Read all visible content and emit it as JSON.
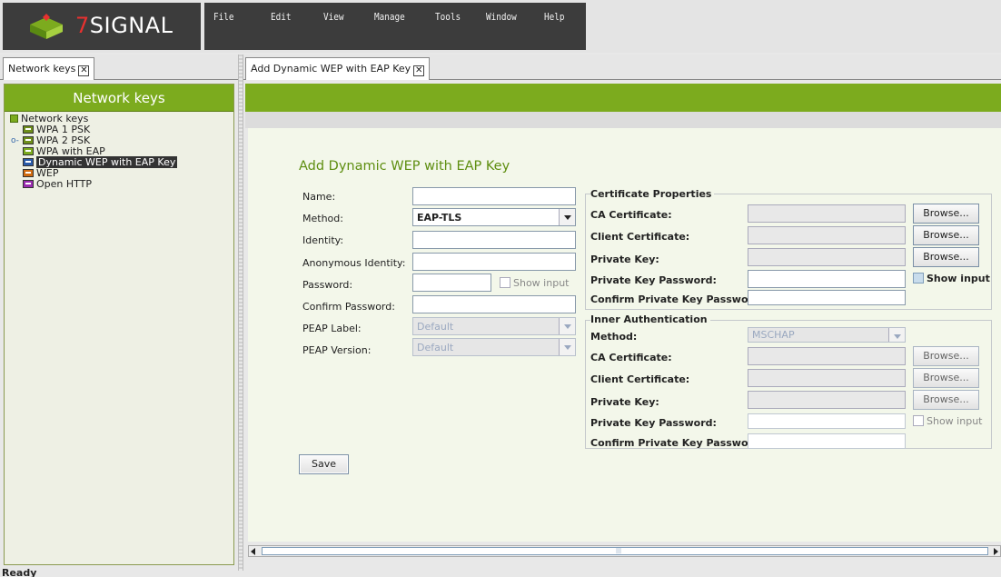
{
  "brand": {
    "name_prefix": "7",
    "name_suffix": "SIGNAL"
  },
  "menu": [
    "File",
    "Edit",
    "View",
    "Manage",
    "Tools",
    "Window",
    "Help"
  ],
  "left": {
    "tab_label": "Network keys",
    "panel_title": "Network keys",
    "tree_root": "Network keys",
    "items": [
      {
        "label": "WPA 1 PSK",
        "color": "#6e8e1a"
      },
      {
        "label": "WPA 2 PSK",
        "color": "#6e8e1a"
      },
      {
        "label": "WPA with EAP",
        "color": "#7cab1e"
      },
      {
        "label": "Dynamic WEP with EAP Key",
        "color": "#2a5aa8"
      },
      {
        "label": "WEP",
        "color": "#d06a10"
      },
      {
        "label": "Open HTTP",
        "color": "#9a2bb0"
      }
    ]
  },
  "right": {
    "tab_label": "Add Dynamic WEP with EAP Key"
  },
  "form": {
    "title": "Add Dynamic WEP with EAP Key",
    "labels": {
      "name": "Name:",
      "method": "Method:",
      "identity": "Identity:",
      "anonymous_identity": "Anonymous Identity:",
      "password": "Password:",
      "confirm_password": "Confirm Password:",
      "peap_label": "PEAP Label:",
      "peap_version": "PEAP Version:"
    },
    "method_value": "EAP-TLS",
    "peap_label_value": "Default",
    "peap_version_value": "Default",
    "show_input": "Show input",
    "save": "Save"
  },
  "cert": {
    "legend": "Certificate Properties",
    "ca": "CA Certificate:",
    "client": "Client Certificate:",
    "private_key": "Private Key:",
    "pk_password": "Private Key Password:",
    "confirm_pk_password": "Confirm Private Key Password:",
    "browse": "Browse...",
    "show_input": "Show input"
  },
  "inner": {
    "legend": "Inner Authentication",
    "method": "Method:",
    "method_value": "MSCHAP",
    "ca": "CA Certificate:",
    "client": "Client Certificate:",
    "private_key": "Private Key:",
    "pk_password": "Private Key Password:",
    "confirm_pk_password": "Confirm Private Key Password:",
    "browse": "Browse...",
    "show_input": "Show input"
  },
  "status": "Ready"
}
